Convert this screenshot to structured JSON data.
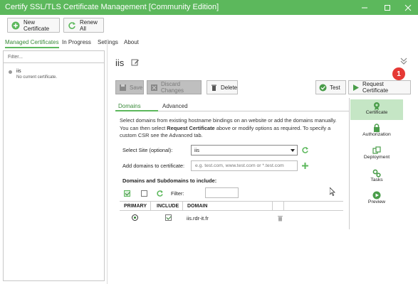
{
  "window": {
    "title": "Certify SSL/TLS Certificate Management [Community Edition]"
  },
  "toolbar": {
    "new_certificate": "New Certificate",
    "renew_all": "Renew All"
  },
  "nav_tabs": [
    "Managed Certificates",
    "In Progress",
    "Settings",
    "About"
  ],
  "left_panel": {
    "filter_placeholder": "Filter...",
    "items": [
      {
        "name": "iis",
        "status": "No current certificate."
      }
    ]
  },
  "detail": {
    "title": "iis",
    "buttons": {
      "save": "Save",
      "discard": "Discard Changes",
      "delete": "Delete",
      "test": "Test",
      "request": "Request Certificate"
    },
    "badge": "1",
    "subtabs": [
      "Domains",
      "Advanced"
    ],
    "description_parts": [
      "Select domains from existing hostname bindings on an website or add the domains manually. You can then select ",
      "Request Certificate",
      " above or modify options as required. To specify a custom CSR see the Advanced tab."
    ],
    "select_site_label": "Select Site (optional):",
    "select_site_value": "iis",
    "add_domains_label": "Add domains to certificate:",
    "add_domains_placeholder": "e.g. test.com, www.test.com or *.test.com",
    "section_title": "Domains and Subdomains to include:",
    "filter_label": "Filter:",
    "grid": {
      "headers": [
        "PRIMARY",
        "INCLUDE",
        "DOMAIN"
      ],
      "rows": [
        {
          "primary": true,
          "include": true,
          "domain": "iis.rdr-it.fr"
        }
      ]
    }
  },
  "side_nav": [
    {
      "label": "Certificate",
      "icon": "certificate-icon",
      "active": true
    },
    {
      "label": "Authorization",
      "icon": "lock-icon",
      "active": false
    },
    {
      "label": "Deployment",
      "icon": "deployment-icon",
      "active": false
    },
    {
      "label": "Tasks",
      "icon": "gears-icon",
      "active": false
    },
    {
      "label": "Preview",
      "icon": "play-circle-icon",
      "active": false
    }
  ],
  "colors": {
    "accent": "#5cb85c",
    "badge": "#e53935",
    "active_nav": "#c5e6c5"
  }
}
